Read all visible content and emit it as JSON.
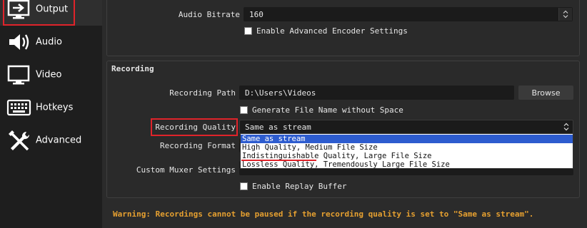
{
  "sidebar": {
    "items": [
      {
        "label": "Output",
        "icon": "output-icon",
        "active": true
      },
      {
        "label": "Audio",
        "icon": "audio-icon"
      },
      {
        "label": "Video",
        "icon": "video-icon"
      },
      {
        "label": "Hotkeys",
        "icon": "keyboard-icon"
      },
      {
        "label": "Advanced",
        "icon": "tools-icon"
      }
    ]
  },
  "streaming": {
    "audio_bitrate_label": "Audio Bitrate",
    "audio_bitrate_value": "160",
    "enable_advanced_encoder_label": "Enable Advanced Encoder Settings",
    "enable_advanced_encoder_checked": false
  },
  "recording": {
    "title": "Recording",
    "path_label": "Recording Path",
    "path_value": "D:\\Users\\Videos",
    "browse_label": "Browse",
    "generate_filename_label": "Generate File Name without Space",
    "generate_filename_checked": false,
    "quality_label": "Recording Quality",
    "quality_value": "Same as stream",
    "quality_options": [
      "Same as stream",
      "High Quality, Medium File Size",
      "Indistinguishable Quality, Large File Size",
      "Lossless Quality, Tremendously Large File Size"
    ],
    "format_label": "Recording Format",
    "custom_muxer_label": "Custom Muxer Settings",
    "enable_replay_buffer_label": "Enable Replay Buffer",
    "enable_replay_buffer_checked": false
  },
  "warning": "Warning: Recordings cannot be paused if the recording quality is set to \"Same as stream\".",
  "colors": {
    "highlight_red": "#e0232a",
    "selection_blue": "#2d5ccf",
    "warning_orange": "#e6a030"
  }
}
